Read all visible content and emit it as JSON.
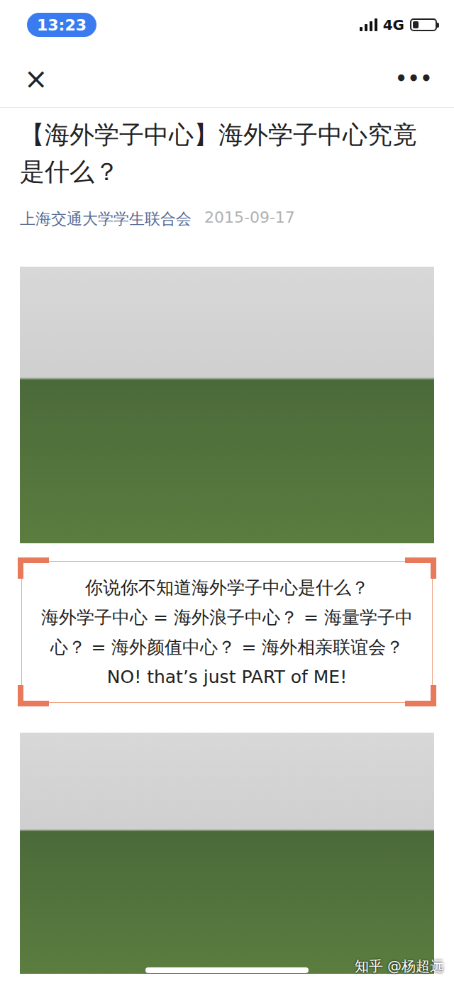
{
  "status_bar": {
    "time": "13:23",
    "network": "4G",
    "signal_level": 1,
    "battery_level": 0.25
  },
  "nav": {
    "close": "×",
    "more": "•••"
  },
  "article": {
    "title": "【海外学子中心】海外学子中心究竟是什么？",
    "author": "上海交通大学学生联合会",
    "date": "2015-09-17",
    "intro_box": [
      "你说你不知道海外学子中心是什么？",
      "海外学子中心 = 海外浪子中心？ = 海量学子中心？ = 海外颜值中心？ = 海外相亲联谊会？",
      "NO! that’s just PART of ME!"
    ]
  },
  "watermark": "知乎 @杨超远"
}
